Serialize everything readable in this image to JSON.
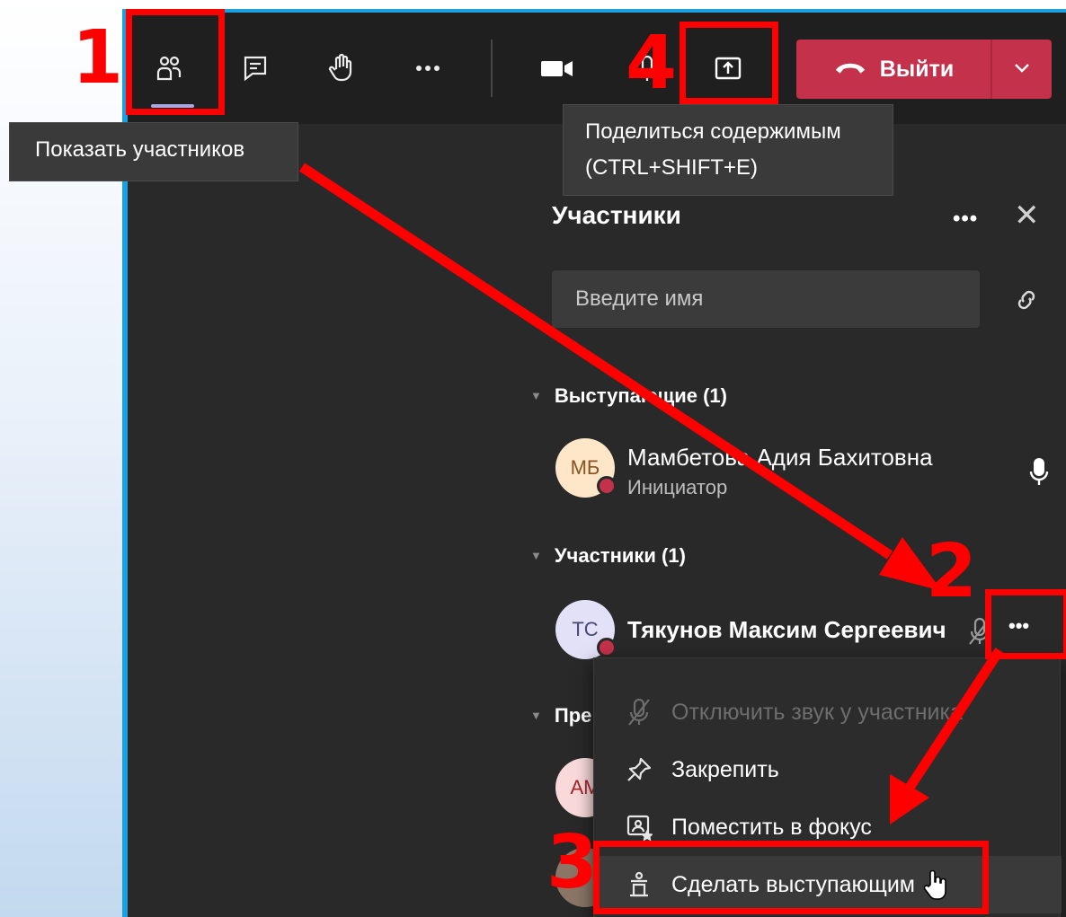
{
  "toolbar": {
    "leave_label": "Выйти"
  },
  "tooltips": {
    "participants": "Показать участников",
    "share_line1": "Поделиться содержимым",
    "share_line2": "(CTRL+SHIFT+E)"
  },
  "panel": {
    "title": "Участники",
    "search_placeholder": "Введите имя",
    "groups": [
      {
        "label": "Выступающие (1)"
      },
      {
        "label": "Участники (1)"
      },
      {
        "label": "Пре"
      }
    ],
    "presenter": {
      "initials": "МБ",
      "name": "Мамбетова Адия Бахитовна",
      "role": "Инициатор"
    },
    "attendee": {
      "initials": "ТС",
      "name": "Тякунов Максим Сергеевич"
    },
    "third_initials": "AM"
  },
  "menu": {
    "items": [
      {
        "label": "Отключить звук у участника",
        "icon": "mic-off-icon",
        "disabled": true
      },
      {
        "label": "Закрепить",
        "icon": "pin-icon"
      },
      {
        "label": "Поместить в фокус",
        "icon": "spotlight-icon"
      },
      {
        "label": "Сделать выступающим",
        "icon": "presenter-icon"
      }
    ]
  },
  "annotations": {
    "step1": "1",
    "step2": "2",
    "step3": "3",
    "step4": "4",
    "color": "#ff0000"
  },
  "colors": {
    "accent": "#1ba0e2",
    "leave": "#c4314b",
    "panel_bg": "#292929",
    "toolbar_bg": "#1f1f1f"
  }
}
